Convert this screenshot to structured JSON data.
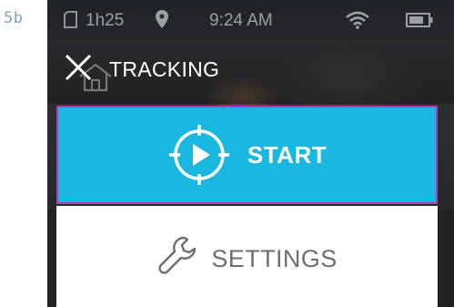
{
  "figure_label": "5b",
  "status_bar": {
    "recording_time": "1h25",
    "clock": "9:24 AM",
    "icons": [
      "sd-card-icon",
      "location-pin-icon",
      "wifi-icon",
      "battery-icon"
    ]
  },
  "header": {
    "title": "TRACKING",
    "icons": [
      "close-icon",
      "home-icon"
    ]
  },
  "menu": {
    "start_label": "START",
    "settings_label": "SETTINGS"
  },
  "colors": {
    "start_bg": "#1ab8e0",
    "focus_border": "#b13cbd",
    "settings_text": "#6f6f6f",
    "figure_label": "#7fa7b7"
  }
}
